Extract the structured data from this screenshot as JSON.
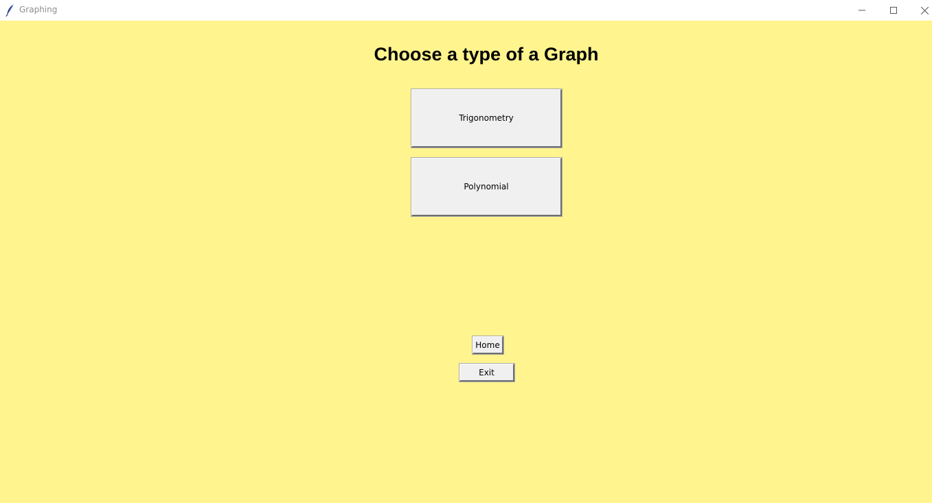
{
  "window": {
    "title": "Graphing",
    "icon": "feather-icon",
    "controls": [
      "minimize-icon",
      "maximize-icon",
      "close-icon"
    ]
  },
  "main": {
    "heading": "Choose a type of a Graph",
    "options": [
      {
        "label": "Trigonometry"
      },
      {
        "label": "Polynomial"
      }
    ],
    "nav": {
      "home_label": "Home",
      "exit_label": "Exit"
    }
  },
  "colors": {
    "background": "#fff48e",
    "button_face": "#f0f0f0",
    "titlebar": "#ffffff"
  }
}
